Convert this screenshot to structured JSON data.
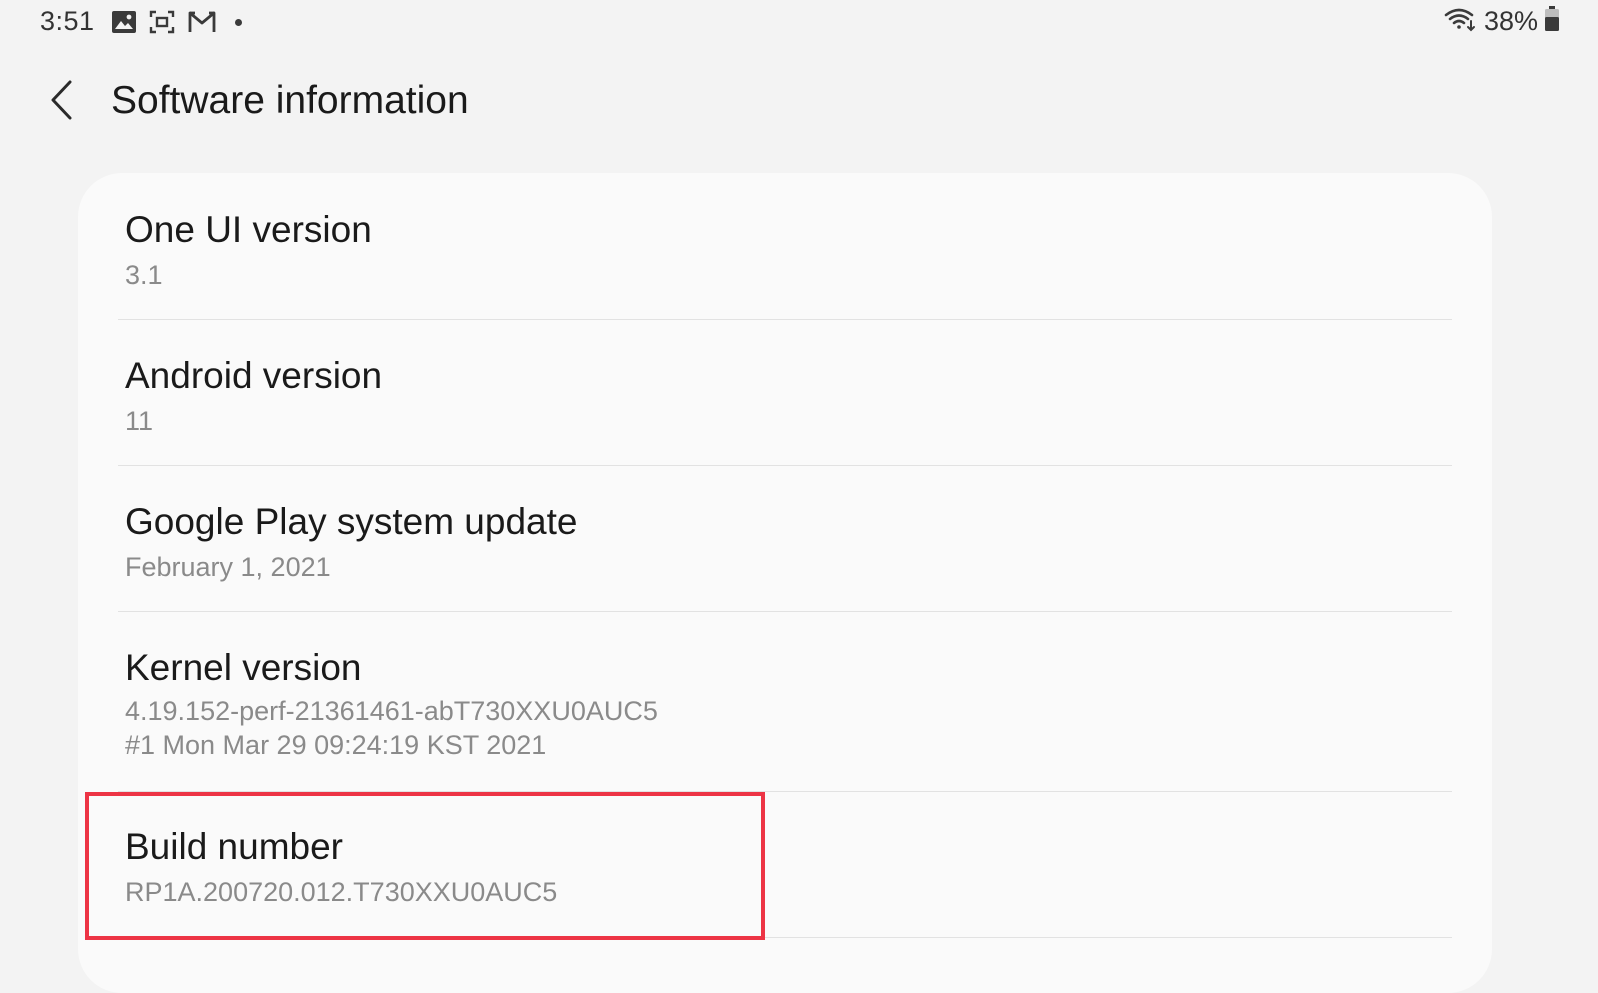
{
  "status_bar": {
    "time": "3:51",
    "notification_icons": [
      "gallery-icon",
      "screenshot-icon",
      "gmail-icon",
      "more-notifications-dot"
    ],
    "battery": "38%",
    "wifi_icon": "wifi-icon",
    "battery_icon": "battery-icon"
  },
  "app_bar": {
    "back_icon": "back-arrow-icon",
    "title": "Software information"
  },
  "items": [
    {
      "title": "One UI version",
      "value": "3.1"
    },
    {
      "title": "Android version",
      "value": "11"
    },
    {
      "title": "Google Play system update",
      "value": "February 1, 2021"
    },
    {
      "title": "Kernel version",
      "value": "4.19.152-perf-21361461-abT730XXU0AUC5\n#1 Mon Mar 29 09:24:19 KST 2021"
    },
    {
      "title": "Build number",
      "value": "RP1A.200720.012.T730XXU0AUC5"
    }
  ],
  "highlight": {
    "target": "Build number",
    "color": "#ed3445"
  },
  "colors": {
    "background": "#f3f3f3",
    "card": "#fafafa",
    "title_text": "#1a1a1a",
    "value_text": "#8a8a8a"
  }
}
